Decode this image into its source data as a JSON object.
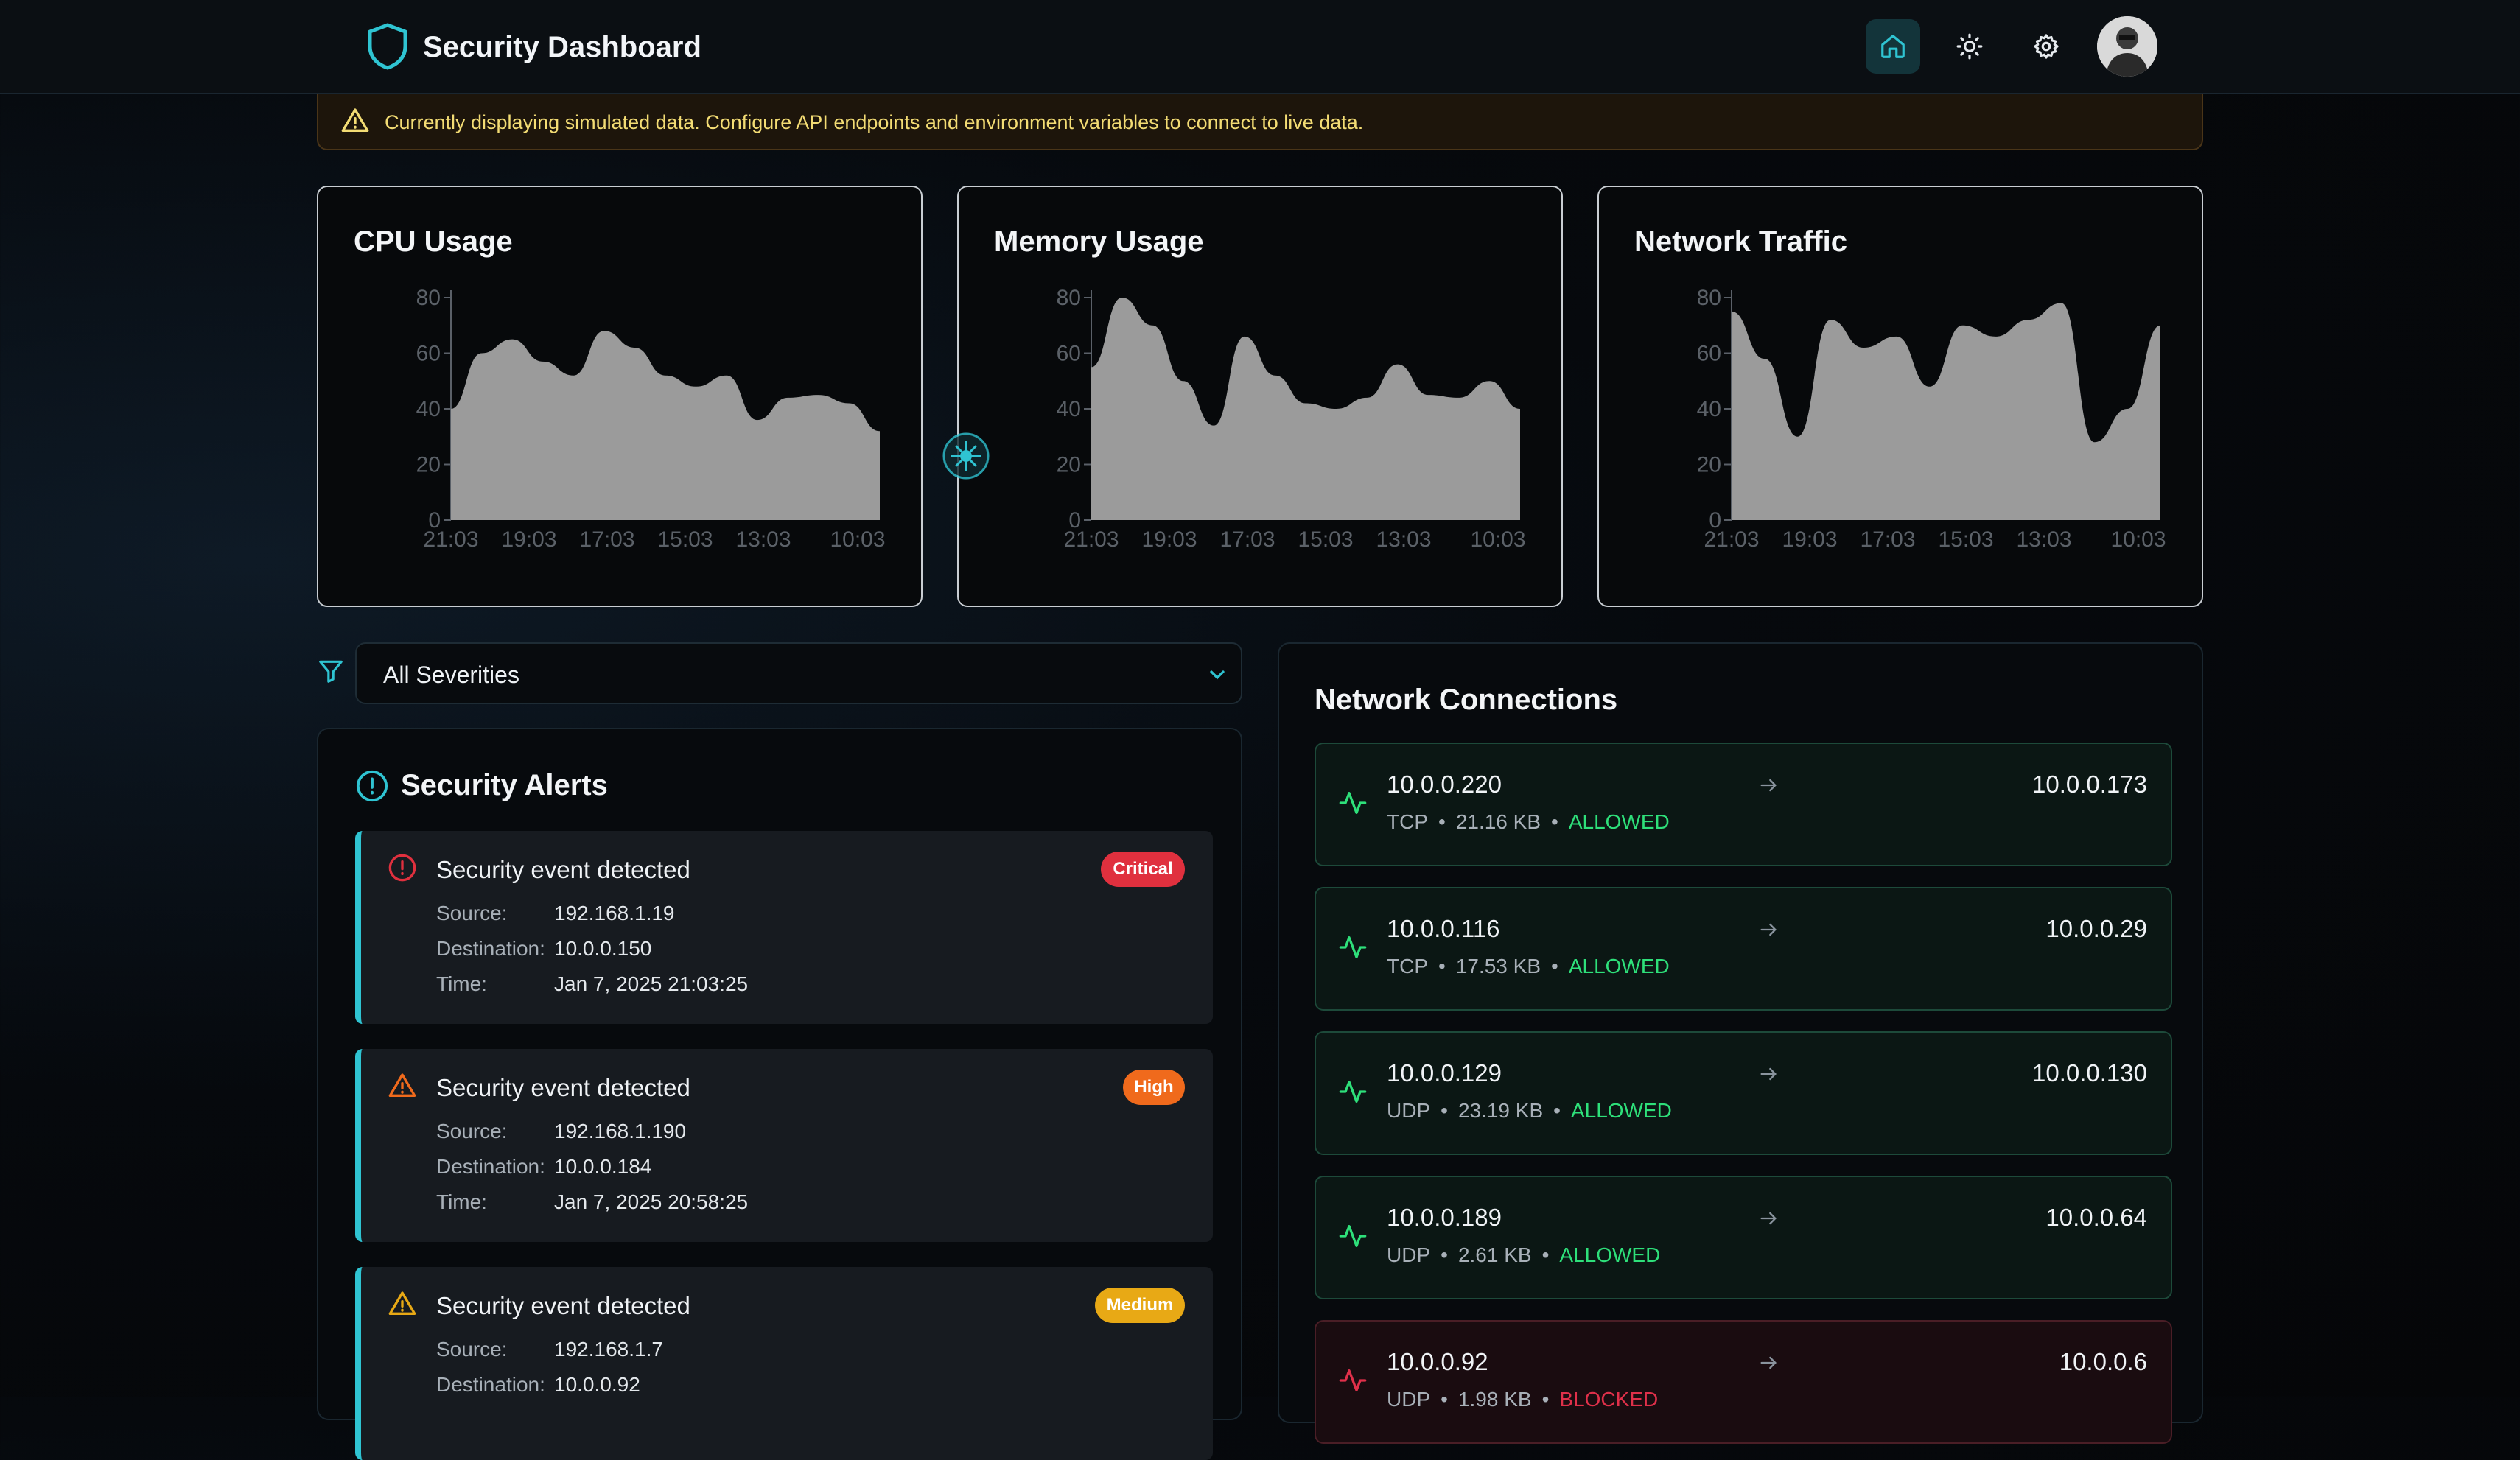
{
  "app": {
    "title": "Security Dashboard"
  },
  "header": {
    "buttons": {
      "home": "home-icon",
      "theme": "sun-icon",
      "settings": "gear-icon"
    },
    "avatar": "user-avatar"
  },
  "banner": {
    "text": "Currently displaying simulated data. Configure API endpoints and environment variables to connect to live data.",
    "icon": "warning-icon"
  },
  "colors": {
    "accent": "#2fc4d2",
    "allowed": "#2ee07a",
    "blocked": "#e0304a",
    "critical": "#e0303e",
    "high": "#f06a1c",
    "medium": "#e8a915"
  },
  "charts": [
    {
      "title": "CPU Usage",
      "chart_data": {
        "type": "area",
        "x": [
          "21:03",
          "19:03",
          "17:03",
          "15:03",
          "13:03",
          "10:03"
        ],
        "y_ticks": [
          0,
          20,
          40,
          60,
          80
        ],
        "ylim": [
          0,
          80
        ],
        "values": [
          40,
          60,
          65,
          57,
          52,
          68,
          62,
          52,
          48,
          52,
          36,
          44,
          45,
          42,
          32
        ]
      }
    },
    {
      "title": "Memory Usage",
      "chart_data": {
        "type": "area",
        "x": [
          "21:03",
          "19:03",
          "17:03",
          "15:03",
          "13:03",
          "10:03"
        ],
        "y_ticks": [
          0,
          20,
          40,
          60,
          80
        ],
        "ylim": [
          0,
          80
        ],
        "values": [
          55,
          80,
          70,
          50,
          34,
          66,
          52,
          42,
          40,
          44,
          56,
          45,
          44,
          50,
          40
        ]
      }
    },
    {
      "title": "Network Traffic",
      "chart_data": {
        "type": "area",
        "x": [
          "21:03",
          "19:03",
          "17:03",
          "15:03",
          "13:03",
          "10:03"
        ],
        "y_ticks": [
          0,
          20,
          40,
          60,
          80
        ],
        "ylim": [
          0,
          80
        ],
        "values": [
          75,
          58,
          30,
          72,
          62,
          66,
          48,
          70,
          66,
          72,
          78,
          28,
          40,
          70
        ]
      }
    }
  ],
  "filter": {
    "selected": "All Severities"
  },
  "alerts": {
    "title": "Security Alerts",
    "field_labels": {
      "source": "Source:",
      "destination": "Destination:",
      "time": "Time:"
    },
    "items": [
      {
        "heading": "Security event detected",
        "severity": "Critical",
        "source": "192.168.1.19",
        "destination": "10.0.0.150",
        "time": "Jan 7, 2025 21:03:25"
      },
      {
        "heading": "Security event detected",
        "severity": "High",
        "source": "192.168.1.190",
        "destination": "10.0.0.184",
        "time": "Jan 7, 2025 20:58:25"
      },
      {
        "heading": "Security event detected",
        "severity": "Medium",
        "source": "192.168.1.7",
        "destination": "10.0.0.92",
        "time": ""
      }
    ]
  },
  "connections": {
    "title": "Network Connections",
    "items": [
      {
        "src": "10.0.0.220",
        "dst": "10.0.0.173",
        "protocol": "TCP",
        "size": "21.16 KB",
        "status": "ALLOWED"
      },
      {
        "src": "10.0.0.116",
        "dst": "10.0.0.29",
        "protocol": "TCP",
        "size": "17.53 KB",
        "status": "ALLOWED"
      },
      {
        "src": "10.0.0.129",
        "dst": "10.0.0.130",
        "protocol": "UDP",
        "size": "23.19 KB",
        "status": "ALLOWED"
      },
      {
        "src": "10.0.0.189",
        "dst": "10.0.0.64",
        "protocol": "UDP",
        "size": "2.61 KB",
        "status": "ALLOWED"
      },
      {
        "src": "10.0.0.92",
        "dst": "10.0.0.6",
        "protocol": "UDP",
        "size": "1.98 KB",
        "status": "BLOCKED"
      }
    ]
  }
}
